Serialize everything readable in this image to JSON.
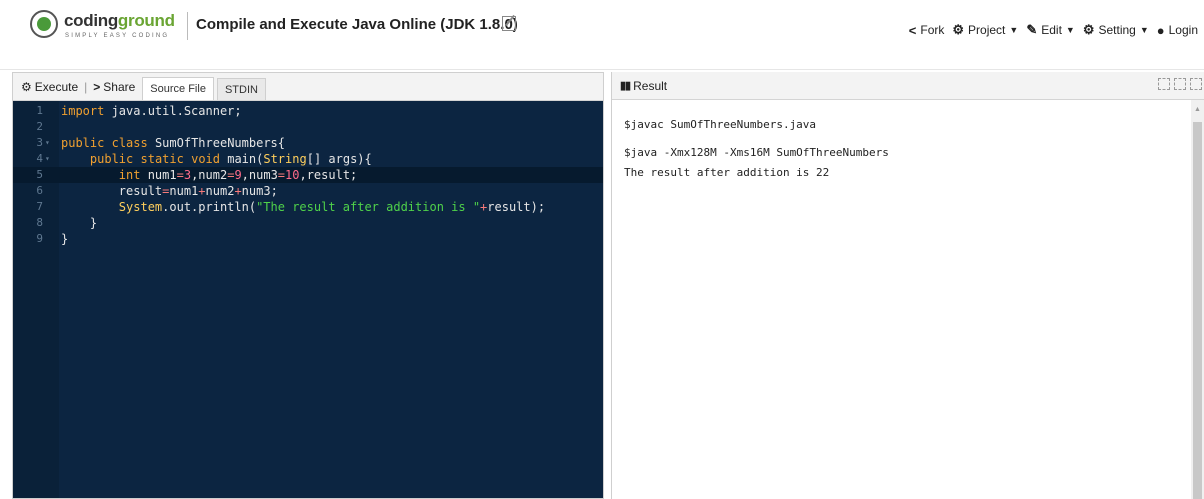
{
  "header": {
    "logo": {
      "word_main": "coding",
      "word_accent": "ground",
      "tagline": "SIMPLY EASY CODING"
    },
    "title": "Compile and Execute Java Online (JDK 1.8.0)",
    "menu": [
      {
        "label": "Fork",
        "icon": "fork-icon",
        "glyph": "⮂"
      },
      {
        "label": "Project",
        "icon": "sitemap-icon",
        "glyph": "☰",
        "dropdown": true
      },
      {
        "label": "Edit",
        "icon": "edit-icon",
        "glyph": "✎",
        "dropdown": true
      },
      {
        "label": "Setting",
        "icon": "gear-icon",
        "glyph": "⚙",
        "dropdown": true
      },
      {
        "label": "Login",
        "icon": "user-icon",
        "glyph": "☻"
      }
    ]
  },
  "editor_panel": {
    "execute_label": "Execute",
    "separator": "|",
    "share_label": "Share",
    "tabs": [
      {
        "label": "Source File",
        "active": true
      },
      {
        "label": "STDIN",
        "active": false
      }
    ],
    "code_lines": [
      {
        "n": "1",
        "text": "import java.util.Scanner;"
      },
      {
        "n": "2",
        "text": ""
      },
      {
        "n": "3",
        "text": "public class SumOfThreeNumbers{"
      },
      {
        "n": "4",
        "text": "    public static void main(String[] args){"
      },
      {
        "n": "5",
        "text": "        int num1=3,num2=9,num3=10,result;"
      },
      {
        "n": "6",
        "text": "        result=num1+num2+num3;"
      },
      {
        "n": "7",
        "text": "        System.out.println(\"The result after addition is \"+result);"
      },
      {
        "n": "8",
        "text": "    }"
      },
      {
        "n": "9",
        "text": "}"
      }
    ],
    "highlighted_line": "5"
  },
  "result_panel": {
    "title": "Result",
    "output_lines": [
      "$javac SumOfThreeNumbers.java",
      "$java -Xmx128M -Xms16M SumOfThreeNumbers",
      "The result after addition is 22"
    ]
  },
  "colors": {
    "editor_bg": "#0c2541",
    "keyword": "#f0a030",
    "number": "#ff6b8a",
    "string": "#4fd14a",
    "logo_accent": "#6aa533"
  }
}
